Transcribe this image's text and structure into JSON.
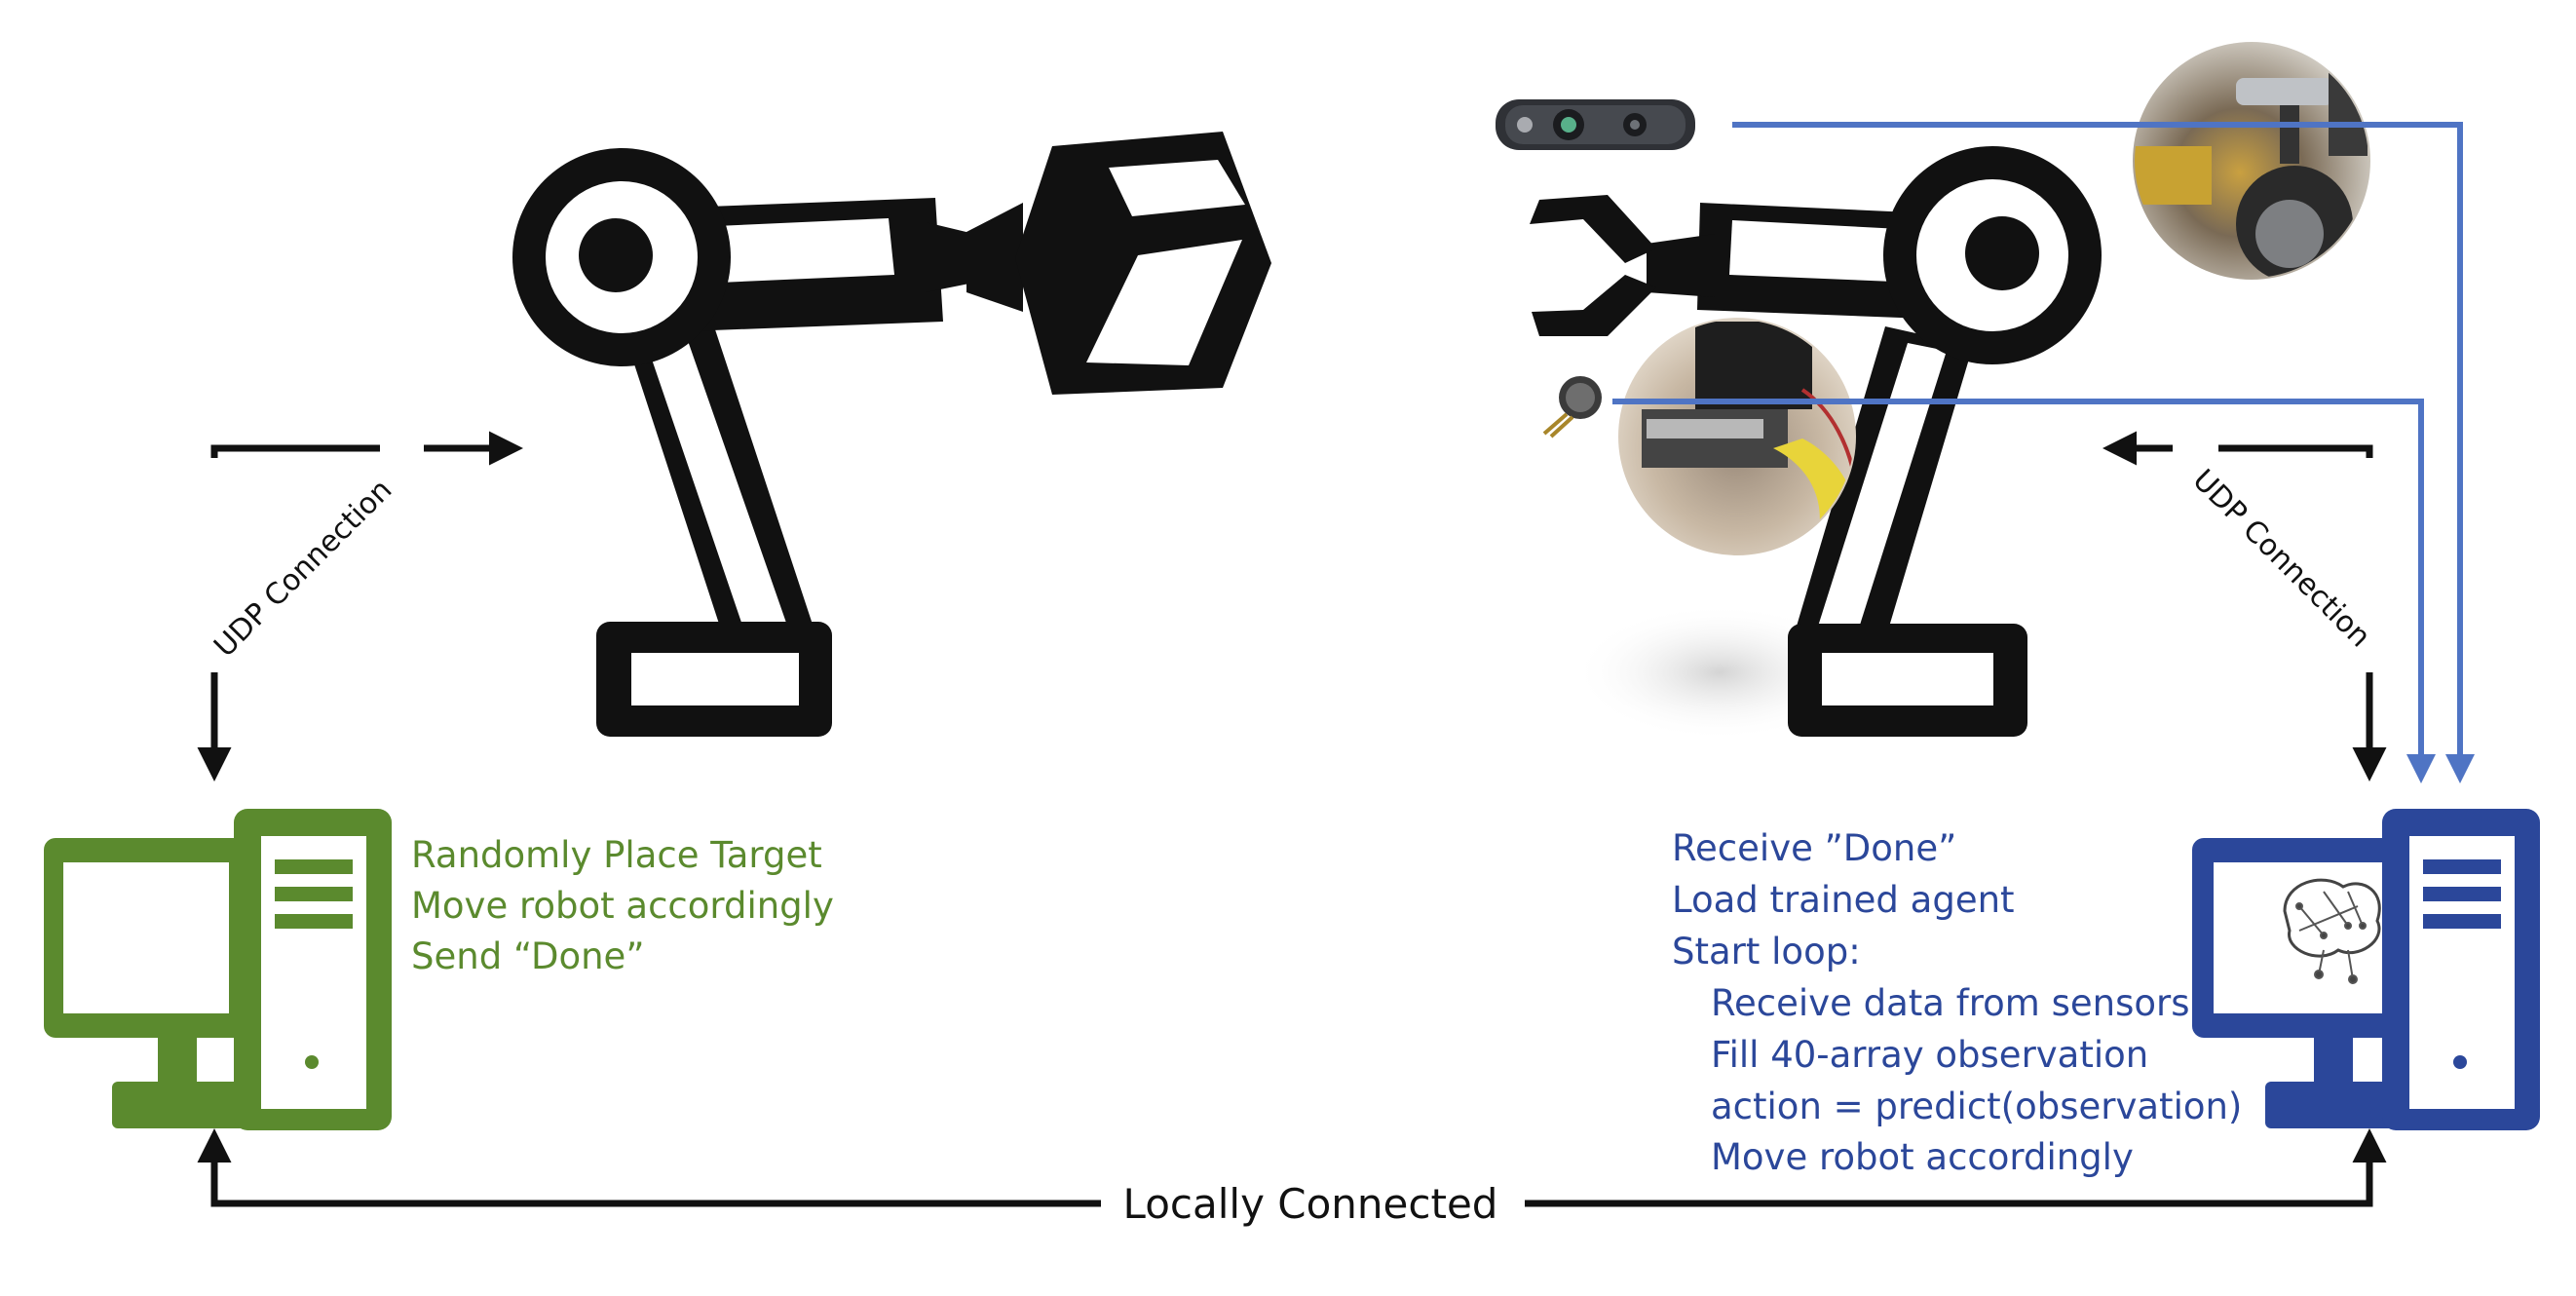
{
  "colors": {
    "green": "#5b8a2e",
    "blue": "#2b479a",
    "sensor_line": "#4f74c4",
    "black": "#111111"
  },
  "left_udp_label": "UDP Connection",
  "right_udp_label": "UDP Connection",
  "bottom_label": "Locally Connected",
  "left_computer": {
    "lines": [
      "Randomly Place Target",
      "Move robot accordingly",
      "Send “Done”"
    ]
  },
  "right_computer": {
    "lines": [
      "Receive ”Done”",
      "Load trained agent",
      "Start loop:"
    ],
    "loop_lines": [
      "Receive data from sensors",
      "Fill 40-array observation",
      "action = predict(observation)",
      "Move robot accordingly"
    ]
  },
  "icons": {
    "left_robot": "robot-arm-cube-icon",
    "right_robot": "robot-arm-gripper-icon",
    "camera": "depth-camera-icon",
    "force_sensor": "force-sensor-icon",
    "brain": "neural-network-brain-icon"
  }
}
